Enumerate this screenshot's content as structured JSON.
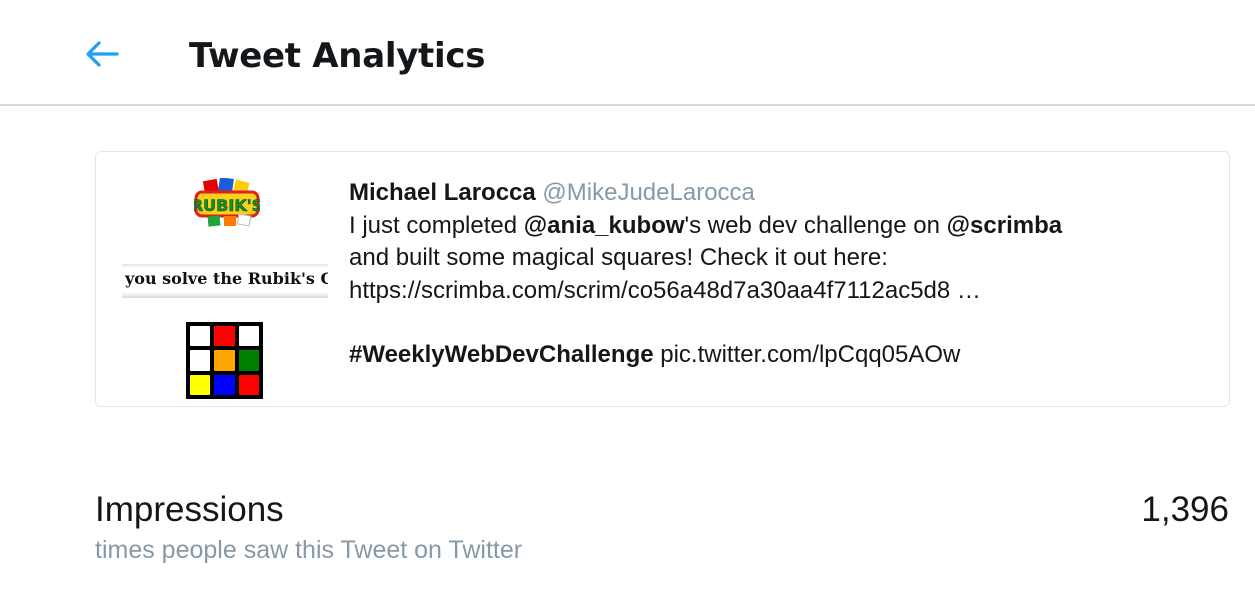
{
  "header": {
    "back_icon": "arrow-left-icon",
    "title": "Tweet Analytics"
  },
  "tweet": {
    "author_name": "Michael Larocca",
    "author_handle": "@MikeJudeLarocca",
    "text": {
      "part1": "I just completed ",
      "mention1": "@ania_kubow",
      "part2": "'s web dev challenge on ",
      "mention2": "@scrimba",
      "line2": "and built some magical squares! Check it out here:",
      "line3": "https://scrimba.com/scrim/co56a48d7a30aa4f7112ac5d8 …",
      "hashtag": "#WeeklyWebDevChallenge",
      "pic_link": " pic.twitter.com/lpCqq05AOw"
    },
    "media": {
      "logo_text": "RUBIK'S",
      "caption": "you solve the Rubik's C",
      "cube_colors": [
        "#ffffff",
        "#ff0000",
        "#ffffff",
        "#ffffff",
        "#ffa500",
        "#008000",
        "#ffff00",
        "#0000ff",
        "#ff0000"
      ]
    }
  },
  "metrics": {
    "impressions_label": "Impressions",
    "impressions_desc": "times people saw this Tweet on Twitter",
    "impressions_value": "1,396"
  },
  "colors": {
    "accent": "#1da1f2",
    "secondary_text": "#8899a6",
    "border": "#e1e8ed"
  }
}
